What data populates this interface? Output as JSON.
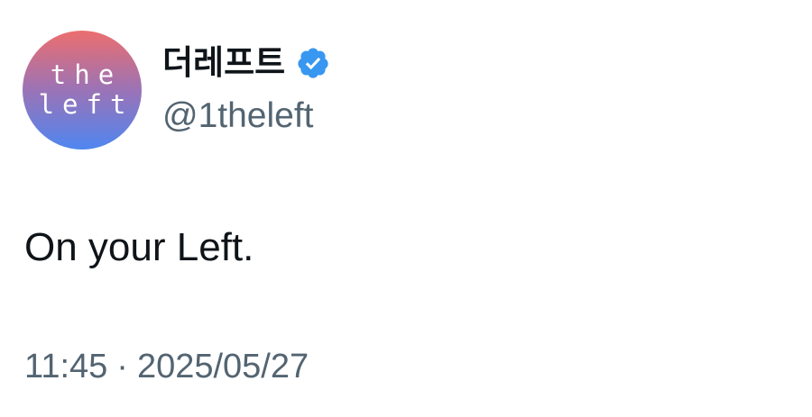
{
  "author": {
    "avatar_line_1": "the",
    "avatar_line_2": "left",
    "display_name": "더레프트",
    "handle": "@1theleft",
    "verified_icon": "verified-badge-icon",
    "verified_color": "#3897f0"
  },
  "tweet": {
    "text": "On your Left.",
    "time": "11:45",
    "separator": "·",
    "date": "2025/05/27"
  },
  "colors": {
    "avatar_gradient_top": "#ec6e6e",
    "avatar_gradient_bottom": "#4f86f0",
    "text_primary": "#0f1419",
    "text_secondary": "#536471"
  }
}
